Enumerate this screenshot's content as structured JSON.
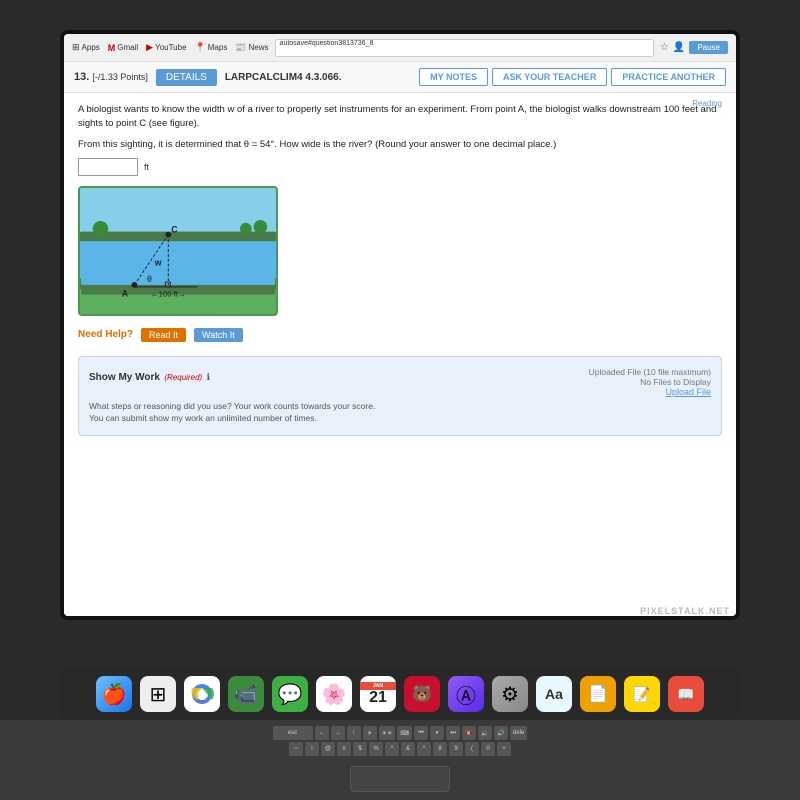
{
  "browser": {
    "url": "autosave#question3813736_8",
    "bookmarks": [
      "Apps",
      "Gmail",
      "YouTube",
      "Maps",
      "News"
    ],
    "pause_label": "Pause"
  },
  "problem": {
    "number": "13.",
    "points": "[-/1.33 Points]",
    "details_label": "DETAILS",
    "code": "LARPCALCLIM4 4.3.066.",
    "my_notes_label": "MY NOTES",
    "ask_teacher_label": "ASK YOUR TEACHER",
    "practice_another_label": "PRACTICE ANOTHER",
    "text_line1": "A biologist wants to know the width w of a river to properly set instruments for an experiment. From point A, the biologist walks downstream 100 feet and sights to point C (see figure).",
    "text_line2": "From this sighting, it is determined that θ = 54°. How wide is the river? (Round your answer to one decimal place.)",
    "answer_unit": "ft",
    "answer_placeholder": ""
  },
  "help": {
    "need_help_label": "Need Help?",
    "read_it_label": "Read It",
    "watch_it_label": "Watch It"
  },
  "show_work": {
    "title": "Show My Work",
    "required_label": "(Required)",
    "description1": "What steps or reasoning did you use? Your work counts towards your score.",
    "description2": "You can submit show my work an unlimited number of times.",
    "uploaded_file_label": "Uploaded File (10 file maximum)",
    "no_files_label": "No Files to Display",
    "upload_btn_label": "Upload File"
  },
  "watermark": "PIXELSTALK.NET",
  "dock": {
    "month": "JAN",
    "day": "21"
  },
  "reading_indicator": "Reading"
}
